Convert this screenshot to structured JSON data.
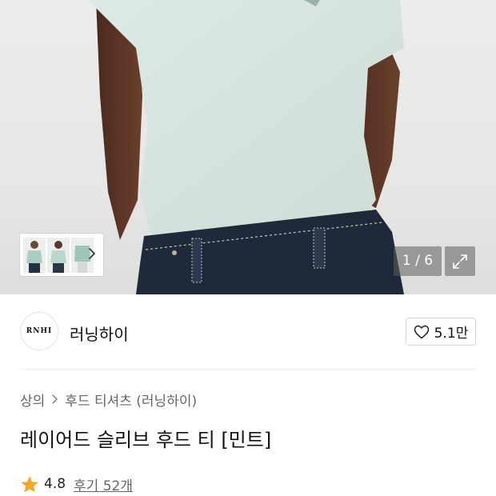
{
  "gallery": {
    "counter": "1 / 6",
    "icons": {
      "next_thumb": "chevron-right-icon",
      "expand": "expand-arrows-icon"
    }
  },
  "seller": {
    "logo_text": "RNHI",
    "name": "러닝하이",
    "like_count": "5.1만",
    "like_icon": "heart-outline-icon"
  },
  "breadcrumb": {
    "category": "상의",
    "subcategory": "후드 티셔츠 (러닝하이)",
    "separator_icon": "chevron-right-icon"
  },
  "product": {
    "title": "레이어드 슬리브 후드 티 [민트]",
    "rating": "4.8",
    "reviews": "후기 52개",
    "star_color": "#F5A623"
  }
}
